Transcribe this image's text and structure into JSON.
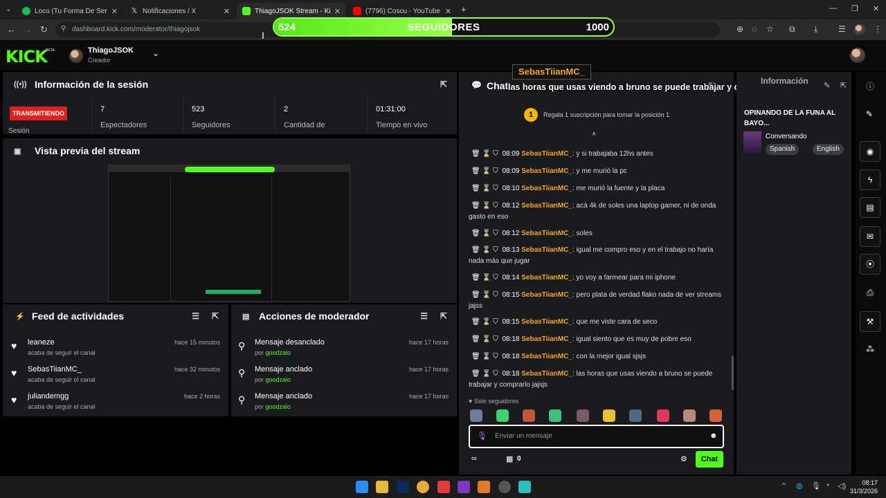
{
  "browser": {
    "tabs": [
      {
        "title": "Loco (Tu Forma De Ser) • L",
        "fav_color": "#1db954"
      },
      {
        "title": "Notificaciones / X",
        "fav_color": "#000000"
      },
      {
        "title": "ThiagoJSOK Stream - Kick Dash",
        "fav_color": "#53fc18"
      },
      {
        "title": "(7796) Coscu - YouTube",
        "fav_color": "#ff0000"
      }
    ],
    "url": "dashboard.kick.com/moderator/thiagojsok"
  },
  "goal_bar": {
    "current": "524",
    "label": "SEGUIDORES",
    "goal": "1000",
    "progress": 0.524
  },
  "header": {
    "logo": "KICK",
    "logo_beta": "BETA",
    "user_name": "ThiagoJSOK",
    "user_role": "Creador"
  },
  "session": {
    "title": "Información de la sesión",
    "live_label": "TRANSMITIENDO",
    "live_sub": "Sesión",
    "stats": [
      {
        "value": "7",
        "label": "Espectadores"
      },
      {
        "value": "523",
        "label": "Seguidores"
      },
      {
        "value": "2",
        "label": "Cantidad de"
      },
      {
        "value": "01:31:00",
        "label": "Tiempo en vivo"
      }
    ]
  },
  "preview": {
    "title": "Vista previa del stream"
  },
  "feed": {
    "title": "Feed de actividades",
    "items": [
      {
        "name": "leaneze",
        "sub": "acaba de seguir el canal",
        "time": "hace 15 minutos"
      },
      {
        "name": "SebasTiianMC_",
        "sub": "acaba de seguir el canal",
        "time": "hace 32 minutos"
      },
      {
        "name": "juliandemgg",
        "sub": "acaba de seguir el canal",
        "time": "hace 2 horas"
      }
    ]
  },
  "mod_actions": {
    "title": "Acciones de moderador",
    "by_prefix": "por",
    "items": [
      {
        "name": "Mensaje desanclado",
        "by": "goodzalo",
        "time": "hace 17 horas"
      },
      {
        "name": "Mensaje anclado",
        "by": "goodzalo",
        "time": "hace 17 horas"
      },
      {
        "name": "Mensaje anclado",
        "by": "goodzalo",
        "time": "hace 17 horas"
      }
    ]
  },
  "chat": {
    "title": "Chat",
    "gift_rank": "1",
    "gift_text": "Regala 1 suscripción para tomar la posición 1",
    "messages": [
      {
        "time": "08:09",
        "user": "SebasTiianMC_",
        "text": "y si trabajaba 12hs antes"
      },
      {
        "time": "08:09",
        "user": "SebasTiianMC_",
        "text": "y me murió la pc"
      },
      {
        "time": "08:10",
        "user": "SebasTiianMC_",
        "text": "me murió la fuente y la placa"
      },
      {
        "time": "08:12",
        "user": "SebasTiianMC_",
        "text": "acá 4k de soles una laptop gamer, ni de onda gasto en eso"
      },
      {
        "time": "08:12",
        "user": "SebasTiianMC_",
        "text": "soles"
      },
      {
        "time": "08:13",
        "user": "SebasTiianMC_",
        "text": "igual me compro eso y en el trabajo no haría nada más que jugar"
      },
      {
        "time": "08:14",
        "user": "SebasTiianMC_",
        "text": "yo voy a farmear para mi iphone"
      },
      {
        "time": "08:15",
        "user": "SebasTiianMC_",
        "text": "pero plata de verdad flako nada de ver streams jajss"
      },
      {
        "time": "08:15",
        "user": "SebasTiianMC_",
        "text": "que me viste cara de seco"
      },
      {
        "time": "08:18",
        "user": "SebasTiianMC_",
        "text": "igual siento que es muy de pobre eso"
      },
      {
        "time": "08:18",
        "user": "SebasTiianMC_",
        "text": "con la mejor igual sjsjs"
      },
      {
        "time": "08:18",
        "user": "SebasTiianMC_",
        "text": "las horas que usas viendo a bruno se puede trabajar y comprarlo jajsjs"
      }
    ],
    "followers_only": "Solo seguidores",
    "input_placeholder": "Enviar un mensaje",
    "points": "0",
    "send_label": "Chat"
  },
  "overlay": {
    "name": "SebasTiianMC_",
    "message": "las horas que usas viendo a bruno se puede trabajar y comprarlo jajsjs"
  },
  "info": {
    "title": "Información",
    "stream_title": "OPINANDO DE LA FUNA AL BAYO...",
    "category": "Conversando",
    "tags": [
      "Spanish",
      "English"
    ]
  },
  "taskbar": {
    "time": "08:17",
    "date": "31/3/2026"
  }
}
